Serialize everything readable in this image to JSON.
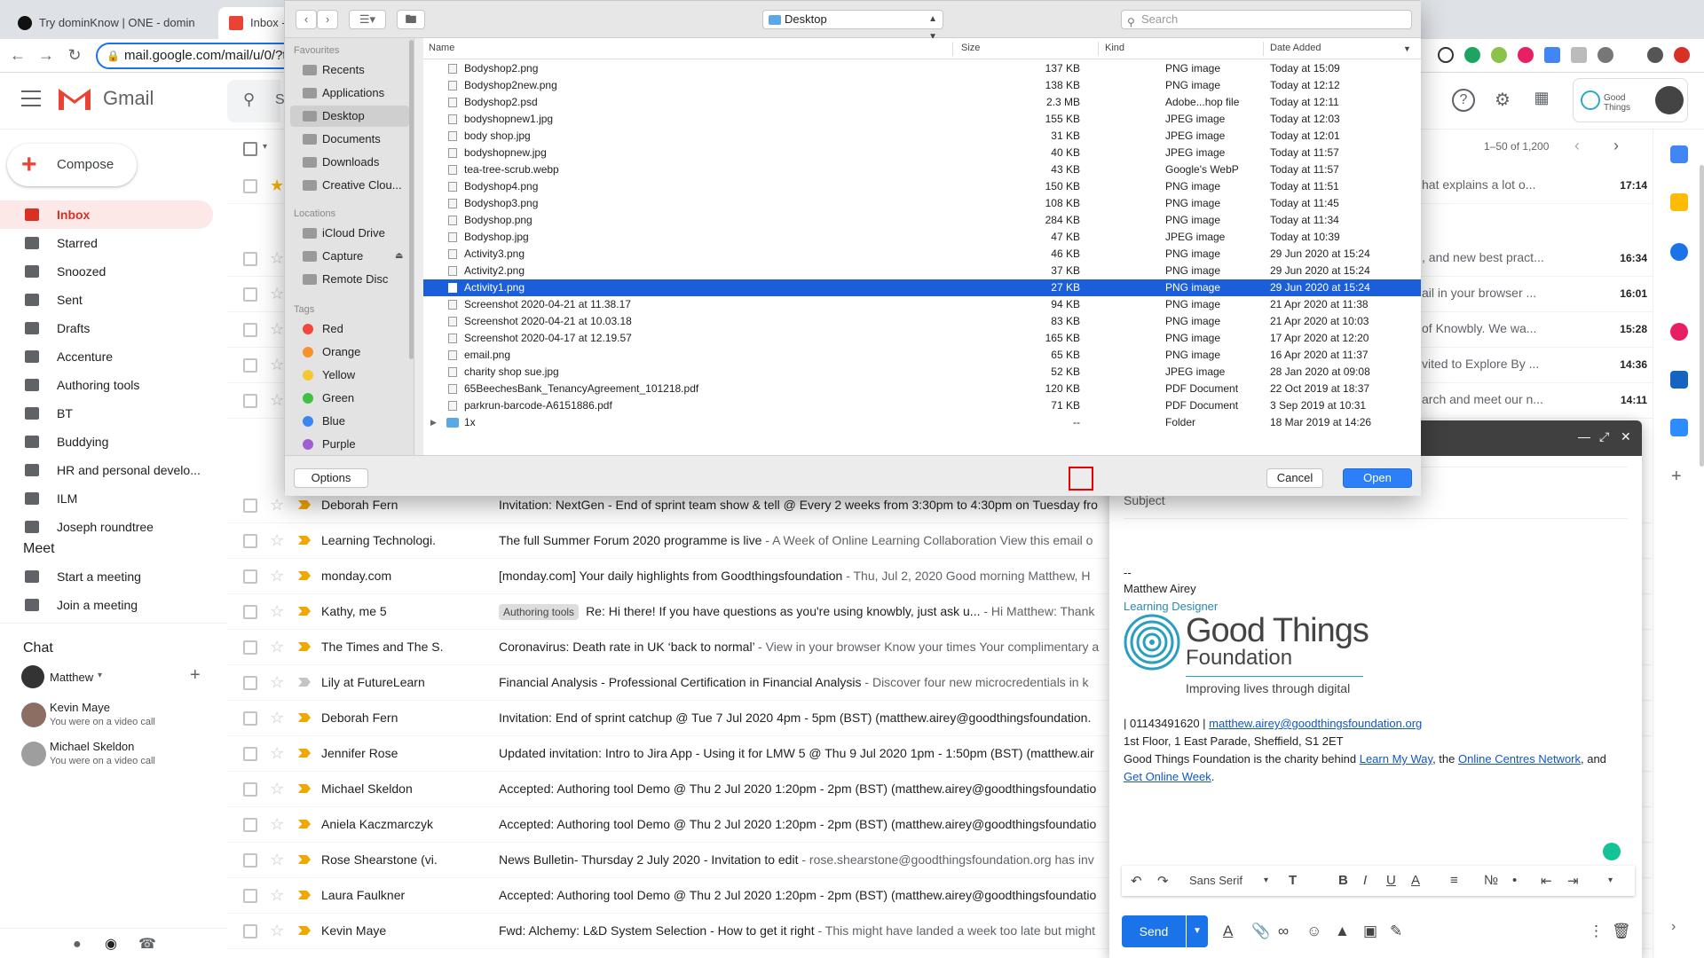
{
  "browser": {
    "tabs": [
      {
        "title": "Try dominKnow | ONE - domin"
      },
      {
        "title": "Inbox - "
      }
    ],
    "url": "mail.google.com/mail/u/0/?t"
  },
  "gmail": {
    "brand": "Gmail",
    "search_placeholder": "S",
    "pagination": "1–50 of 1,200",
    "compose_label": "Compose",
    "nav": [
      {
        "label": "Inbox",
        "active": true
      },
      {
        "label": "Starred"
      },
      {
        "label": "Snoozed"
      },
      {
        "label": "Sent"
      },
      {
        "label": "Drafts"
      },
      {
        "label": "Accenture"
      },
      {
        "label": "Authoring tools"
      },
      {
        "label": "BT"
      },
      {
        "label": "Buddying"
      },
      {
        "label": "HR and personal develo..."
      },
      {
        "label": "ILM"
      },
      {
        "label": "Joseph roundtree"
      }
    ],
    "meet": {
      "title": "Meet",
      "start": "Start a meeting",
      "join": "Join a meeting"
    },
    "chat": {
      "title": "Chat",
      "user": "Matthew",
      "people": [
        {
          "name": "Kevin Maye",
          "status": "You were on a video call"
        },
        {
          "name": "Michael Skeldon",
          "status": "You were on a video call"
        }
      ]
    },
    "partial_rows": [
      {
        "snippet": "hat explains a lot o...",
        "time": "17:14"
      },
      {
        "snippet": ", and new best pract...",
        "time": "16:34"
      },
      {
        "snippet": "ail in your browser ...",
        "time": "16:01"
      },
      {
        "snippet": "of Knowbly. We wa...",
        "time": "15:28"
      },
      {
        "snippet": "vited to Explore By ...",
        "time": "14:36"
      },
      {
        "snippet": "arch and meet our n...",
        "time": "14:11"
      }
    ],
    "rows": [
      {
        "sender": "Deborah Fern",
        "subject": "Invitation: NextGen - End of sprint team show & tell @ Every 2 weeks from 3:30pm to 4:30pm on Tuesday fro",
        "snippet": "",
        "label": ""
      },
      {
        "sender": "Learning Technologi.",
        "subject": "The full Summer Forum 2020 programme is live",
        "snippet": " - A Week of Online Learning Collaboration View this email o",
        "label": ""
      },
      {
        "sender": "monday.com",
        "subject": "[monday.com] Your daily highlights from Goodthingsfoundation",
        "snippet": " - Thu, Jul 2, 2020 Good morning Matthew, H",
        "label": ""
      },
      {
        "sender": "Kathy, me 5",
        "subject": "Re: Hi there! If you have questions as you're using knowbly, just ask u...",
        "snippet": " - Hi Matthew: Thank",
        "label": "Authoring tools"
      },
      {
        "sender": "The Times and The S.",
        "subject": "Coronavirus: Death rate in UK ‘back to normal’",
        "snippet": " - View in your browser Know your times Your complimentary a",
        "label": ""
      },
      {
        "sender": "Lily at FutureLearn",
        "subject": "Financial Analysis - Professional Certification in Financial Analysis",
        "snippet": " - Discover four new microcredentials in k",
        "label": "",
        "unimportant": true
      },
      {
        "sender": "Deborah Fern",
        "subject": "Invitation: End of sprint catchup @ Tue 7 Jul 2020 4pm - 5pm (BST) (matthew.airey@goodthingsfoundation.",
        "snippet": "",
        "label": ""
      },
      {
        "sender": "Jennifer Rose",
        "subject": "Updated invitation: Intro to Jira App - Using it for LMW 5 @ Thu 9 Jul 2020 1pm - 1:50pm (BST) (matthew.air",
        "snippet": "",
        "label": ""
      },
      {
        "sender": "Michael Skeldon",
        "subject": "Accepted: Authoring tool Demo @ Thu 2 Jul 2020 1:20pm - 2pm (BST) (matthew.airey@goodthingsfoundatio",
        "snippet": "",
        "label": ""
      },
      {
        "sender": "Aniela Kaczmarczyk",
        "subject": "Accepted: Authoring tool Demo @ Thu 2 Jul 2020 1:20pm - 2pm (BST) (matthew.airey@goodthingsfoundatio",
        "snippet": "",
        "label": ""
      },
      {
        "sender": "Rose Shearstone (vi.",
        "subject": "News Bulletin- Thursday 2 July 2020 - Invitation to edit",
        "snippet": " - rose.shearstone@goodthingsfoundation.org has inv",
        "label": ""
      },
      {
        "sender": "Laura Faulkner",
        "subject": "Accepted: Authoring tool Demo @ Thu 2 Jul 2020 1:20pm - 2pm (BST) (matthew.airey@goodthingsfoundatio",
        "snippet": "",
        "label": ""
      },
      {
        "sender": "Kevin Maye",
        "subject": "Fwd: Alchemy: L&D System Selection - How to get it right",
        "snippet": " - This might have landed a week too late but might",
        "label": ""
      }
    ]
  },
  "compose": {
    "subject_placeholder": "Subject",
    "sig_dash": "--",
    "sig_name": "Matthew Airey",
    "sig_title": "Learning Designer",
    "logo_line1": "Good Things",
    "logo_line2": "Foundation",
    "logo_tagline": "Improving lives through digital",
    "phone": " | 01143491620 | ",
    "email": "matthew.airey@goodthingsfoundation.org",
    "address": "1st Floor, 1 East Parade, Sheffield, S1 2ET",
    "charity_pre": "Good Things Foundation is the charity behind ",
    "link1": "Learn My Way",
    "charity_mid": ", the ",
    "link2": "Online Centres Network",
    "charity_post": ", and",
    "link3": "Get Online Week",
    "link3_post": ".",
    "font_select": "Sans Serif",
    "send_label": "Send"
  },
  "dialog": {
    "location": "Desktop",
    "search_placeholder": "Search",
    "favourites_title": "Favourites",
    "favourites": [
      "Recents",
      "Applications",
      "Desktop",
      "Documents",
      "Downloads",
      "Creative Clou..."
    ],
    "locations_title": "Locations",
    "locations": [
      "iCloud Drive",
      "Capture",
      "Remote Disc"
    ],
    "tags_title": "Tags",
    "tags": [
      {
        "name": "Red",
        "color": "#f4453f"
      },
      {
        "name": "Orange",
        "color": "#f7922c"
      },
      {
        "name": "Yellow",
        "color": "#f5c733"
      },
      {
        "name": "Green",
        "color": "#41c042"
      },
      {
        "name": "Blue",
        "color": "#3a86f4"
      },
      {
        "name": "Purple",
        "color": "#a15dd2"
      }
    ],
    "columns": {
      "name": "Name",
      "size": "Size",
      "kind": "Kind",
      "date": "Date Added"
    },
    "files": [
      {
        "name": "Bodyshop2.png",
        "size": "137 KB",
        "kind": "PNG image",
        "date": "Today at 15:09"
      },
      {
        "name": "Bodyshop2new.png",
        "size": "138 KB",
        "kind": "PNG image",
        "date": "Today at 12:12"
      },
      {
        "name": "Bodyshop2.psd",
        "size": "2.3 MB",
        "kind": "Adobe...hop file",
        "date": "Today at 12:11"
      },
      {
        "name": "bodyshopnew1.jpg",
        "size": "155 KB",
        "kind": "JPEG image",
        "date": "Today at 12:03"
      },
      {
        "name": "body shop.jpg",
        "size": "31 KB",
        "kind": "JPEG image",
        "date": "Today at 12:01"
      },
      {
        "name": "bodyshopnew.jpg",
        "size": "40 KB",
        "kind": "JPEG image",
        "date": "Today at 11:57"
      },
      {
        "name": "tea-tree-scrub.webp",
        "size": "43 KB",
        "kind": "Google's WebP",
        "date": "Today at 11:57"
      },
      {
        "name": "Bodyshop4.png",
        "size": "150 KB",
        "kind": "PNG image",
        "date": "Today at 11:51"
      },
      {
        "name": "Bodyshop3.png",
        "size": "108 KB",
        "kind": "PNG image",
        "date": "Today at 11:45"
      },
      {
        "name": "Bodyshop.png",
        "size": "284 KB",
        "kind": "PNG image",
        "date": "Today at 11:34"
      },
      {
        "name": "Bodyshop.jpg",
        "size": "47 KB",
        "kind": "JPEG image",
        "date": "Today at 10:39"
      },
      {
        "name": "Activity3.png",
        "size": "46 KB",
        "kind": "PNG image",
        "date": "29 Jun 2020 at 15:24"
      },
      {
        "name": "Activity2.png",
        "size": "37 KB",
        "kind": "PNG image",
        "date": "29 Jun 2020 at 15:24"
      },
      {
        "name": "Activity1.png",
        "size": "27 KB",
        "kind": "PNG image",
        "date": "29 Jun 2020 at 15:24",
        "selected": true
      },
      {
        "name": "Screenshot 2020-04-21 at 11.38.17",
        "size": "94 KB",
        "kind": "PNG image",
        "date": "21 Apr 2020 at 11:38"
      },
      {
        "name": "Screenshot 2020-04-21 at 10.03.18",
        "size": "83 KB",
        "kind": "PNG image",
        "date": "21 Apr 2020 at 10:03"
      },
      {
        "name": "Screenshot 2020-04-17 at 12.19.57",
        "size": "165 KB",
        "kind": "PNG image",
        "date": "17 Apr 2020 at 12:20"
      },
      {
        "name": "email.png",
        "size": "65 KB",
        "kind": "PNG image",
        "date": "16 Apr 2020 at 11:37"
      },
      {
        "name": "charity shop sue.jpg",
        "size": "52 KB",
        "kind": "JPEG image",
        "date": "28 Jan 2020 at 09:08"
      },
      {
        "name": "65BeechesBank_TenancyAgreement_101218.pdf",
        "size": "120 KB",
        "kind": "PDF Document",
        "date": "22 Oct 2019 at 18:37"
      },
      {
        "name": "parkrun-barcode-A6151886.pdf",
        "size": "71 KB",
        "kind": "PDF Document",
        "date": "3 Sep 2019 at 10:31"
      },
      {
        "name": "1x",
        "size": "--",
        "kind": "Folder",
        "date": "18 Mar 2019 at 14:26",
        "folder": true
      }
    ],
    "options_label": "Options",
    "cancel_label": "Cancel",
    "open_label": "Open"
  },
  "colors": {
    "accent": "#1a73e8",
    "inbox_active": "#d93025",
    "selection": "#1a5fd9",
    "important": "#f2a600"
  }
}
